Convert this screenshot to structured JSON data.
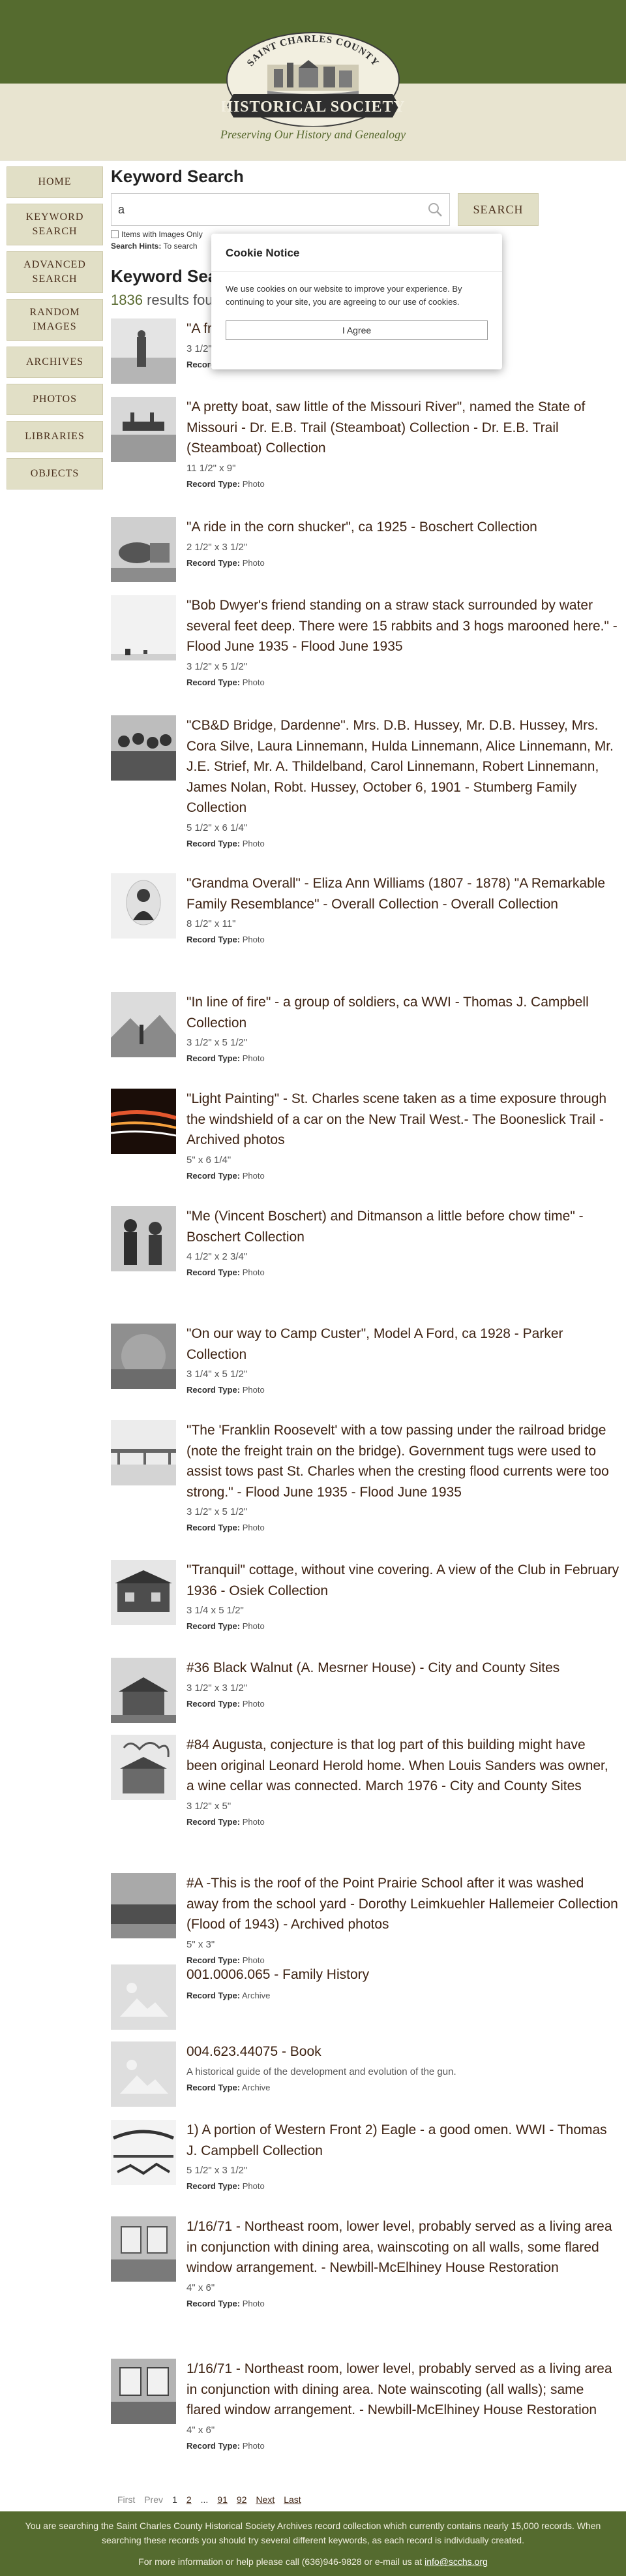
{
  "header": {
    "logo_top": "SAINT CHARLES COUNTY",
    "logo_main": "HISTORICAL SOCIETY",
    "tagline": "Preserving Our History and Genealogy"
  },
  "sidebar": {
    "items": [
      {
        "label": "HOME"
      },
      {
        "label": "KEYWORD SEARCH"
      },
      {
        "label": "ADVANCED SEARCH"
      },
      {
        "label": "RANDOM IMAGES"
      },
      {
        "label": "ARCHIVES"
      },
      {
        "label": "PHOTOS"
      },
      {
        "label": "LIBRARIES"
      },
      {
        "label": "OBJECTS"
      }
    ]
  },
  "search": {
    "title": "Keyword Search",
    "value": "a",
    "button": "SEARCH",
    "images_only_label": "Items with Images Only",
    "hints_label": "Search Hints:",
    "hints_text": "To search"
  },
  "results_header": {
    "title": "Keyword Search",
    "count": "1836",
    "count_suffix": "results found"
  },
  "record_type_label": "Record Type:",
  "results": [
    {
      "title": "\"A friend...\" - Olive Bosner Collection",
      "size": "3 1/2\" x 5\"",
      "type": "Photo"
    },
    {
      "title": "\"A pretty boat, saw little of the Missouri River\", named the State of Missouri - Dr. E.B. Trail (Steamboat) Collection - Dr. E.B. Trail (Steamboat) Collection",
      "size": "11 1/2\" x 9\"",
      "type": "Photo"
    },
    {
      "title": "\"A ride in the corn shucker\", ca 1925 - Boschert Collection",
      "size": "2 1/2\" x 3 1/2\"",
      "type": "Photo"
    },
    {
      "title": "\"Bob Dwyer's friend standing on a straw stack surrounded by water several feet deep. There were 15 rabbits and 3 hogs marooned here.\" - Flood June 1935 - Flood June 1935",
      "size": "3 1/2\" x 5 1/2\"",
      "type": "Photo"
    },
    {
      "title": "\"CB&D Bridge, Dardenne\". Mrs. D.B. Hussey, Mr. D.B. Hussey, Mrs. Cora Silve, Laura Linnemann, Hulda Linnemann, Alice Linnemann, Mr. J.E. Strief, Mr. A. Thildelband, Carol Linnemann, Robert Linnemann, James Nolan, Robt. Hussey, October 6, 1901 - Stumberg Family Collection",
      "size": "5 1/2\" x 6 1/4\"",
      "type": "Photo"
    },
    {
      "title": "\"Grandma Overall\" - Eliza Ann Williams (1807 - 1878) \"A Remarkable Family Resemblance\" - Overall Collection - Overall Collection",
      "size": "8 1/2\" x 11\"",
      "type": "Photo"
    },
    {
      "title": "\"In line of fire\" - a group of soldiers, ca WWI - Thomas J. Campbell Collection",
      "size": "3 1/2\" x 5 1/2\"",
      "type": "Photo"
    },
    {
      "title": "\"Light Painting\" - St. Charles scene taken as a time exposure through the windshield of a car on the New Trail West.- The Booneslick Trail - Archived photos",
      "size": "5\" x 6 1/4\"",
      "type": "Photo"
    },
    {
      "title": "\"Me (Vincent Boschert) and Ditmanson a little before chow time\" - Boschert Collection",
      "size": "4 1/2\" x 2 3/4\"",
      "type": "Photo"
    },
    {
      "title": "\"On our way to Camp Custer\", Model A Ford, ca 1928 - Parker Collection",
      "size": "3 1/4\" x 5 1/2\"",
      "type": "Photo"
    },
    {
      "title": "\"The 'Franklin Roosevelt' with a tow passing under the railroad bridge (note the freight train on the bridge). Government tugs were used to assist tows past St. Charles when the cresting flood currents were too strong.\" - Flood June 1935 - Flood June 1935",
      "size": "3 1/2\" x 5 1/2\"",
      "type": "Photo"
    },
    {
      "title": "\"Tranquil\" cottage, without vine covering. A view of the Club in February 1936 - Osiek Collection",
      "size": "3 1/4 x 5 1/2\"",
      "type": "Photo"
    },
    {
      "title": "#36 Black Walnut (A. Mesrner House) - City and County Sites",
      "size": "3 1/2\" x 3 1/2\"",
      "type": "Photo"
    },
    {
      "title": "#84 Augusta, conjecture is that log part of this building might have been original Leonard Herold home. When Louis Sanders was owner, a wine cellar was connected. March 1976 - City and County Sites",
      "size": "3 1/2\" x 5\"",
      "type": "Photo"
    },
    {
      "title": "#A -This is the roof of the Point Prairie School after it was washed away from the school yard - Dorothy Leimkuehler Hallemeier Collection (Flood of 1943) - Archived photos",
      "size": "5\" x 3\"",
      "type": "Photo"
    },
    {
      "title": "001.0006.065 - Family History",
      "size": "",
      "type": "Archive"
    },
    {
      "title": "004.623.44075 - Book",
      "desc": "A historical guide of the development and evolution of the gun.",
      "size": "",
      "type": "Archive"
    },
    {
      "title": "1) A portion of Western Front 2) Eagle - a good omen. WWI - Thomas J. Campbell Collection",
      "size": "5 1/2\" x 3 1/2\"",
      "type": "Photo"
    },
    {
      "title": "1/16/71 - Northeast room, lower level, probably served as a living area in conjunction with dining area, wainscoting on all walls, some flared window arrangement. - Newbill-McElhiney House Restoration",
      "size": "4\" x 6\"",
      "type": "Photo"
    },
    {
      "title": "1/16/71 - Northeast room, lower level, probably served as a living area in conjunction with dining area. Note wainscoting (all walls); same flared window arrangement. - Newbill-McElhiney House Restoration",
      "size": "4\" x 6\"",
      "type": "Photo"
    }
  ],
  "cookie": {
    "title": "Cookie Notice",
    "text": "We use cookies on our website to improve your experience. By continuing to your site, you are agreeing to our use of cookies.",
    "button": "I Agree"
  },
  "pagination": {
    "first": "First",
    "prev": "Prev",
    "current": "1",
    "page2": "2",
    "ellipsis": "...",
    "page91": "91",
    "page92": "92",
    "next": "Next",
    "last": "Last"
  },
  "footer": {
    "line1": "You are searching the Saint Charles County Historical Society Archives record collection which currently contains nearly 15,000 records. When searching these records you should try several different keywords, as each record is individually created.",
    "line2_prefix": "For more information or help please call (636)946-9828 or e-mail us at",
    "email": "info@scchs.org"
  },
  "colors": {
    "header_green": "#556b2f",
    "header_cream": "#e8e4d0",
    "nav_bg": "#e1dfc6",
    "title_brown": "#3e2313"
  }
}
